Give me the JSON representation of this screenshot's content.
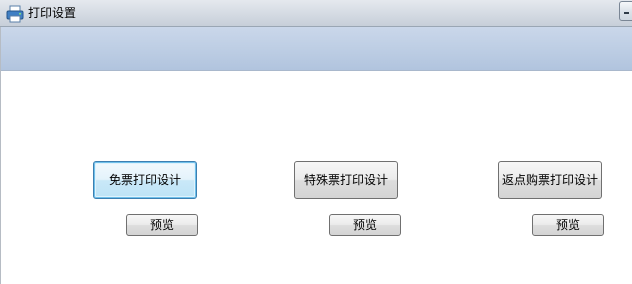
{
  "window": {
    "title": "打印设置"
  },
  "buttons": {
    "design": [
      {
        "label": "免票打印设计"
      },
      {
        "label": "特殊票打印设计"
      },
      {
        "label": "返点购票打印设计"
      }
    ],
    "preview": [
      {
        "label": "预览"
      },
      {
        "label": "预览"
      },
      {
        "label": "预览"
      }
    ]
  },
  "icons": {
    "app": "printer-app-icon",
    "minimize": "minimize-icon"
  },
  "colors": {
    "banner": "#bfcfe5",
    "titlebar": "#d6dce4",
    "focus_border": "#3c7fb1"
  }
}
